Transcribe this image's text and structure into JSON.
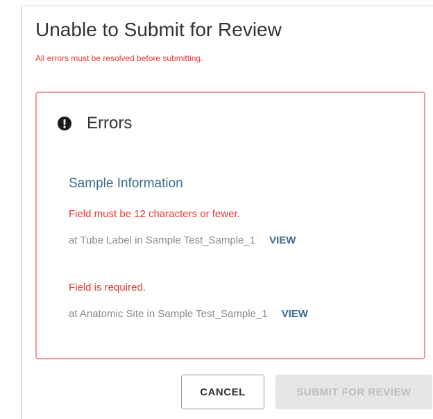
{
  "dialog": {
    "title": "Unable to Submit for Review",
    "subtitle": "All errors must be resolved before submitting."
  },
  "errors_panel": {
    "icon": "alert-circle-icon",
    "title": "Errors",
    "section_title": "Sample Information",
    "items": [
      {
        "message": "Field must be 12 characters or fewer.",
        "location": "at Tube Label in Sample Test_Sample_1",
        "link_label": "VIEW"
      },
      {
        "message": "Field is required.",
        "location": "at Anatomic Site in Sample Test_Sample_1",
        "link_label": "VIEW"
      }
    ]
  },
  "actions": {
    "cancel_label": "CANCEL",
    "submit_label": "SUBMIT FOR REVIEW",
    "submit_disabled": true
  },
  "colors": {
    "error": "#e53935",
    "link": "#3c6e8f",
    "panel_border": "#ef9a9a"
  }
}
